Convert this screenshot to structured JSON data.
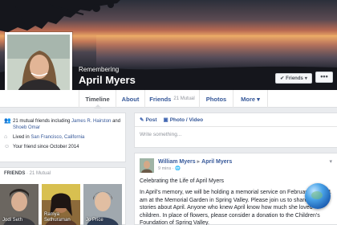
{
  "profile": {
    "remembering_label": "Remembering",
    "name": "April Myers"
  },
  "actions": {
    "friends_button_label": "Friends",
    "more_button_label": "•••"
  },
  "tabs": [
    {
      "label": "Timeline",
      "count": ""
    },
    {
      "label": "About",
      "count": ""
    },
    {
      "label": "Friends",
      "count": "21 Mutual"
    },
    {
      "label": "Photos",
      "count": ""
    },
    {
      "label": "More",
      "count": ""
    }
  ],
  "intro": {
    "mutual_prefix": "21 mutual friends including ",
    "mutual_friend_1": "James R. Hairston",
    "mutual_and": " and",
    "mutual_friend_2": "Shoeb Omar",
    "lived_prefix": "Lived in ",
    "lived_place": "San Francisco, California",
    "friend_since": "Your friend since October 2014"
  },
  "friends_box": {
    "title": "FRIENDS",
    "subtitle": "· 21 Mutual",
    "tiles": [
      {
        "name_line1": "Jodi Seth",
        "name_line2": ""
      },
      {
        "name_line1": "Ramya",
        "name_line2": "Sethuraman"
      },
      {
        "name_line1": "Jo Price",
        "name_line2": ""
      }
    ]
  },
  "composer": {
    "post_tab": "Post",
    "photo_tab": "Photo / Video",
    "placeholder": "Write something..."
  },
  "post": {
    "author": "William Myers",
    "target": "April Myers",
    "meta": "9 mins · ",
    "title": "Celebrating the Life of April Myers",
    "body": "In April's memory, we will be holding a memorial service on February 15 at 11 am at the Memorial Garden in Spring Valley. Please join us to share your stories about April. Anyone who knew April know how much she loved children. In place of flowers, please consider a donation to the Children's Foundation of Spring Valley."
  }
}
